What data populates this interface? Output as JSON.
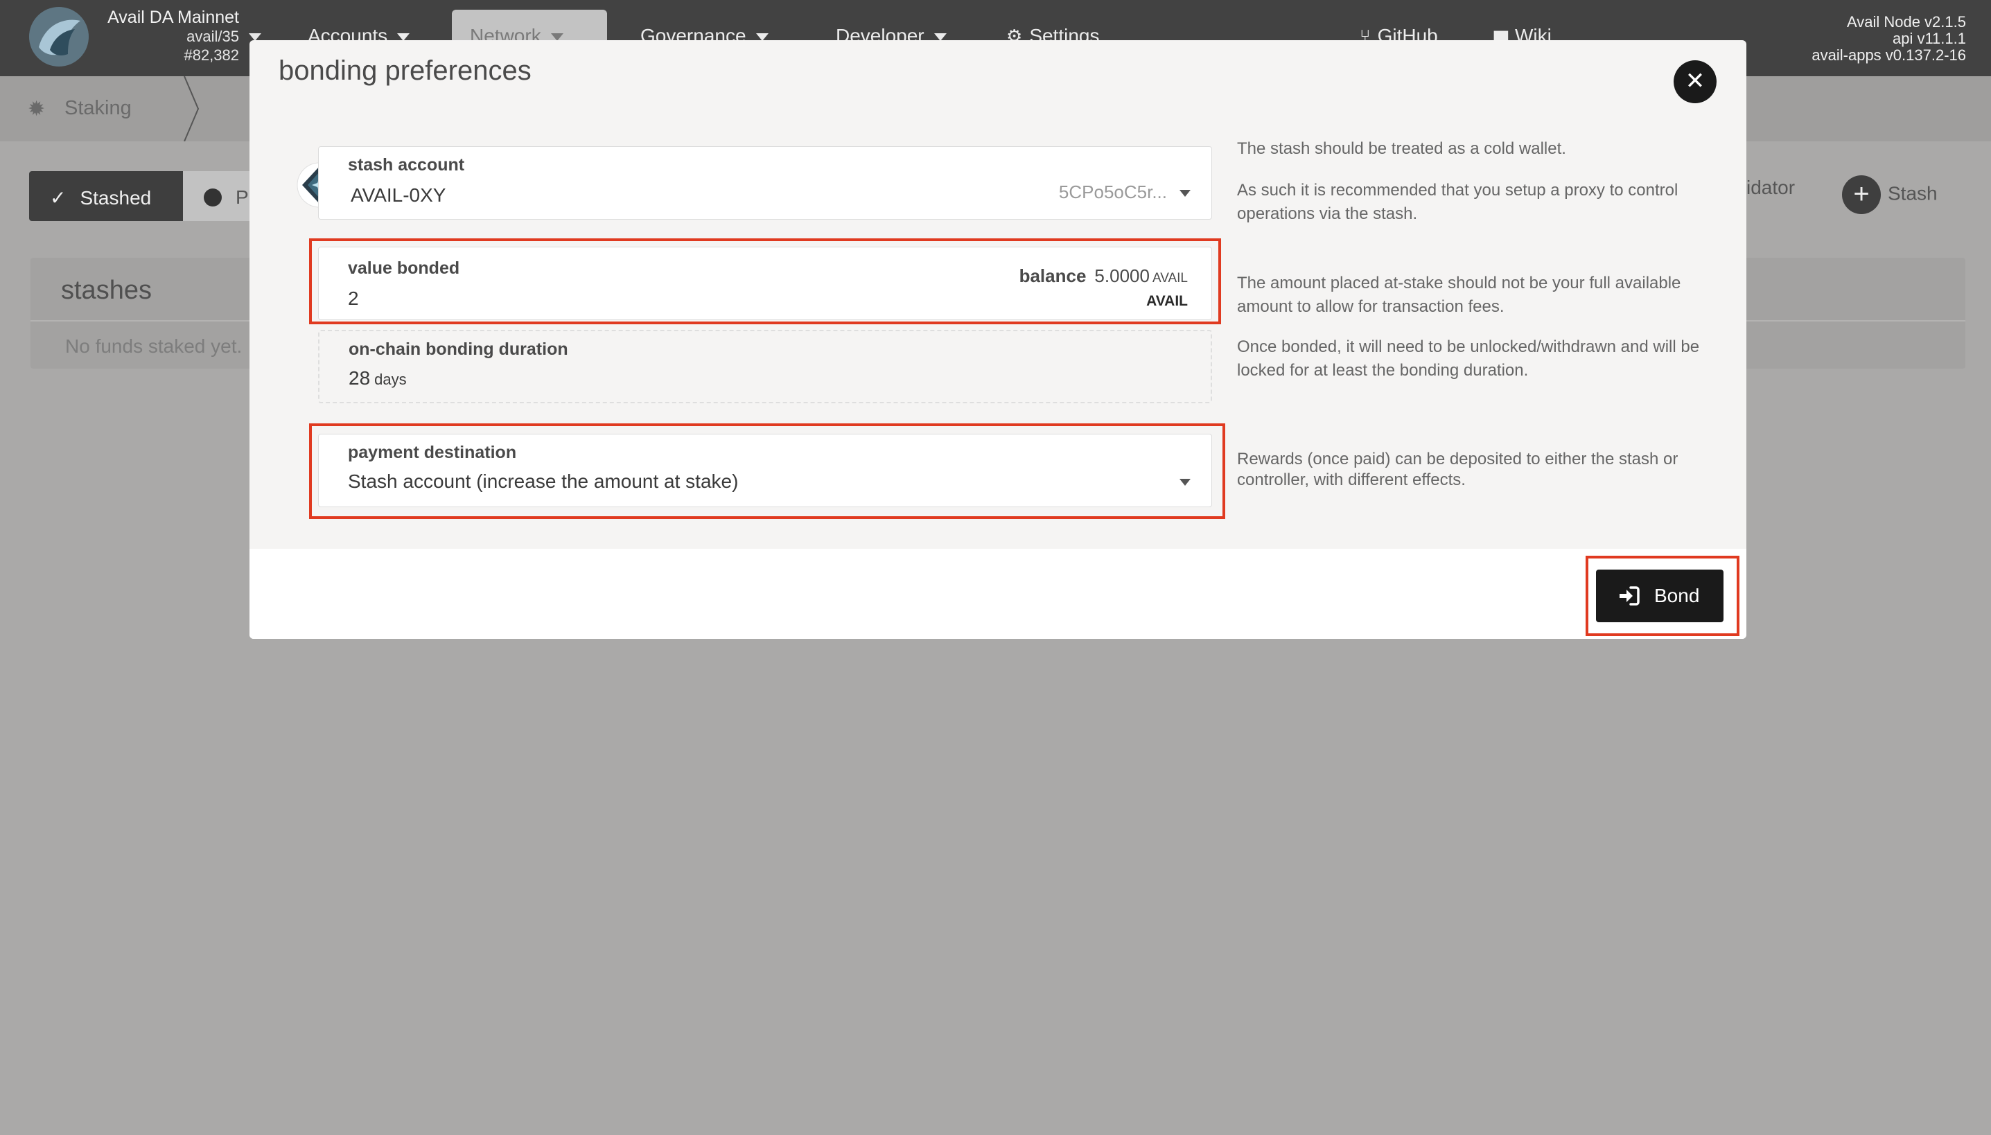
{
  "topbar": {
    "chain_name": "Avail DA Mainnet",
    "chain_version": "avail/35",
    "block": "#82,382",
    "nav": [
      {
        "label": "Accounts"
      },
      {
        "label": "Network"
      },
      {
        "label": "Governance"
      },
      {
        "label": "Developer"
      },
      {
        "label": "Settings"
      },
      {
        "label": "GitHub"
      },
      {
        "label": "Wiki"
      }
    ],
    "node_info": [
      "Avail Node v2.1.5",
      "api v11.1.1",
      "avail-apps v0.137.2-16"
    ]
  },
  "subnav": {
    "section": "Staking"
  },
  "page": {
    "tabs": [
      {
        "label": "Stashed"
      },
      {
        "label": "P"
      }
    ],
    "actions": [
      {
        "label": "idator"
      },
      {
        "label": "Stash"
      }
    ],
    "stashes_title": "stashes",
    "stashes_empty": "No funds staked yet."
  },
  "modal": {
    "title": "bonding preferences",
    "stash": {
      "label": "stash account",
      "name": "AVAIL-0XY",
      "address": "5CPo5oC5r..."
    },
    "value_bonded": {
      "label": "value bonded",
      "value": "2",
      "unit": "AVAIL",
      "balance_label": "balance",
      "balance_value": "5.0000",
      "balance_unit": "AVAIL"
    },
    "duration": {
      "label": "on-chain bonding duration",
      "value": "28",
      "unit": "days"
    },
    "payment": {
      "label": "payment destination",
      "value": "Stash account (increase the amount at stake)"
    },
    "help": {
      "stash_1": "The stash should be treated as a cold wallet.",
      "stash_2": "As such it is recommended that you setup a proxy to control operations via the stash.",
      "bond": "The amount placed at-stake should not be your full available amount to allow for transaction fees.",
      "duration": "Once bonded, it will need to be unlocked/withdrawn and will be locked for at least the bonding duration.",
      "payment": "Rewards (once paid) can be deposited to either the stash or controller, with different effects."
    },
    "bond_button": "Bond"
  },
  "colors": {
    "highlight": "#e03a20",
    "primary_button": "#1a1a1a",
    "topbar": "#424242"
  }
}
